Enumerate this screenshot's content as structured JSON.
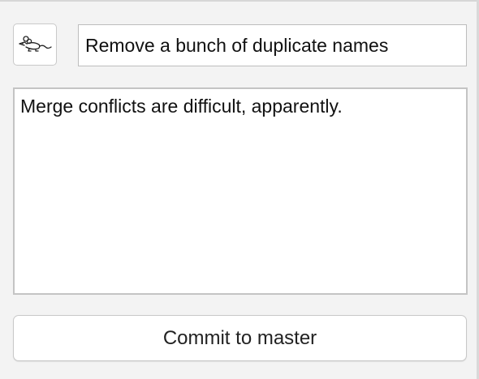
{
  "commit_form": {
    "avatar_icon": "rat-avatar-icon",
    "summary": {
      "value": "Remove a bunch of duplicate names"
    },
    "description": {
      "value": "Merge conflicts are difficult, apparently."
    },
    "commit_button": {
      "label": "Commit to master"
    }
  }
}
